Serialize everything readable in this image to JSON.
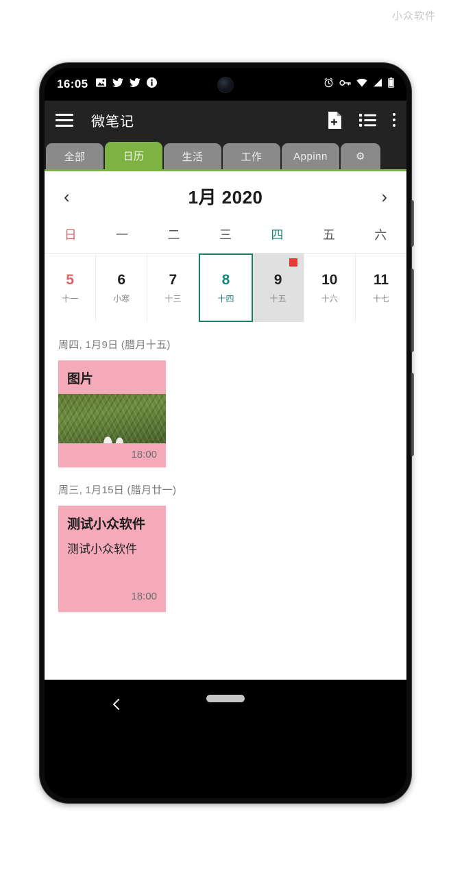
{
  "watermark": "小众软件",
  "status_bar": {
    "time": "16:05",
    "left_icons": [
      "image-icon",
      "twitter-icon",
      "twitter-icon",
      "info-circle-icon"
    ],
    "right_icons": [
      "alarm-icon",
      "vpn-key-icon",
      "wifi-icon",
      "signal-icon",
      "battery-icon"
    ]
  },
  "app_bar": {
    "menu_icon": "hamburger-menu-icon",
    "title": "微笔记",
    "actions": [
      "new-note-icon",
      "list-view-icon",
      "overflow-menu-icon"
    ]
  },
  "tabs": [
    {
      "label": "全部",
      "active": false,
      "type": "text"
    },
    {
      "label": "日历",
      "active": true,
      "type": "text"
    },
    {
      "label": "生活",
      "active": false,
      "type": "text"
    },
    {
      "label": "工作",
      "active": false,
      "type": "text"
    },
    {
      "label": "Appinn",
      "active": false,
      "type": "text"
    },
    {
      "label": "⚙",
      "active": false,
      "type": "gear"
    }
  ],
  "calendar": {
    "prev_label": "‹",
    "next_label": "›",
    "title": "1月 2020",
    "weekdays": [
      "日",
      "一",
      "二",
      "三",
      "四",
      "五",
      "六"
    ],
    "days": [
      {
        "num": "5",
        "lunar": "十一",
        "sunday": true,
        "today": false,
        "selected": false,
        "marker": false
      },
      {
        "num": "6",
        "lunar": "小寒",
        "sunday": false,
        "today": false,
        "selected": false,
        "marker": false
      },
      {
        "num": "7",
        "lunar": "十三",
        "sunday": false,
        "today": false,
        "selected": false,
        "marker": false
      },
      {
        "num": "8",
        "lunar": "十四",
        "sunday": false,
        "today": true,
        "selected": false,
        "marker": false
      },
      {
        "num": "9",
        "lunar": "十五",
        "sunday": false,
        "today": false,
        "selected": true,
        "marker": true
      },
      {
        "num": "10",
        "lunar": "十六",
        "sunday": false,
        "today": false,
        "selected": false,
        "marker": false
      },
      {
        "num": "11",
        "lunar": "十七",
        "sunday": false,
        "today": false,
        "selected": false,
        "marker": false
      }
    ]
  },
  "event_groups": [
    {
      "date_label": "周四, 1月9日 (腊月十五)",
      "note": {
        "title": "图片",
        "body": "",
        "has_image": true,
        "time": "18:00"
      }
    },
    {
      "date_label": "周三, 1月15日 (腊月廿一)",
      "note": {
        "title": "测试小众软件",
        "body": "测试小众软件",
        "has_image": false,
        "time": "18:00"
      }
    }
  ],
  "nav_bar": {
    "back_icon": "back-chevron-icon",
    "home_pill": "home-pill-icon"
  },
  "colors": {
    "accent_green": "#7cb342",
    "today_teal": "#19857b",
    "note_pink": "#f4aab9",
    "marker_red": "#e53935",
    "sunday_red": "#e06666"
  }
}
